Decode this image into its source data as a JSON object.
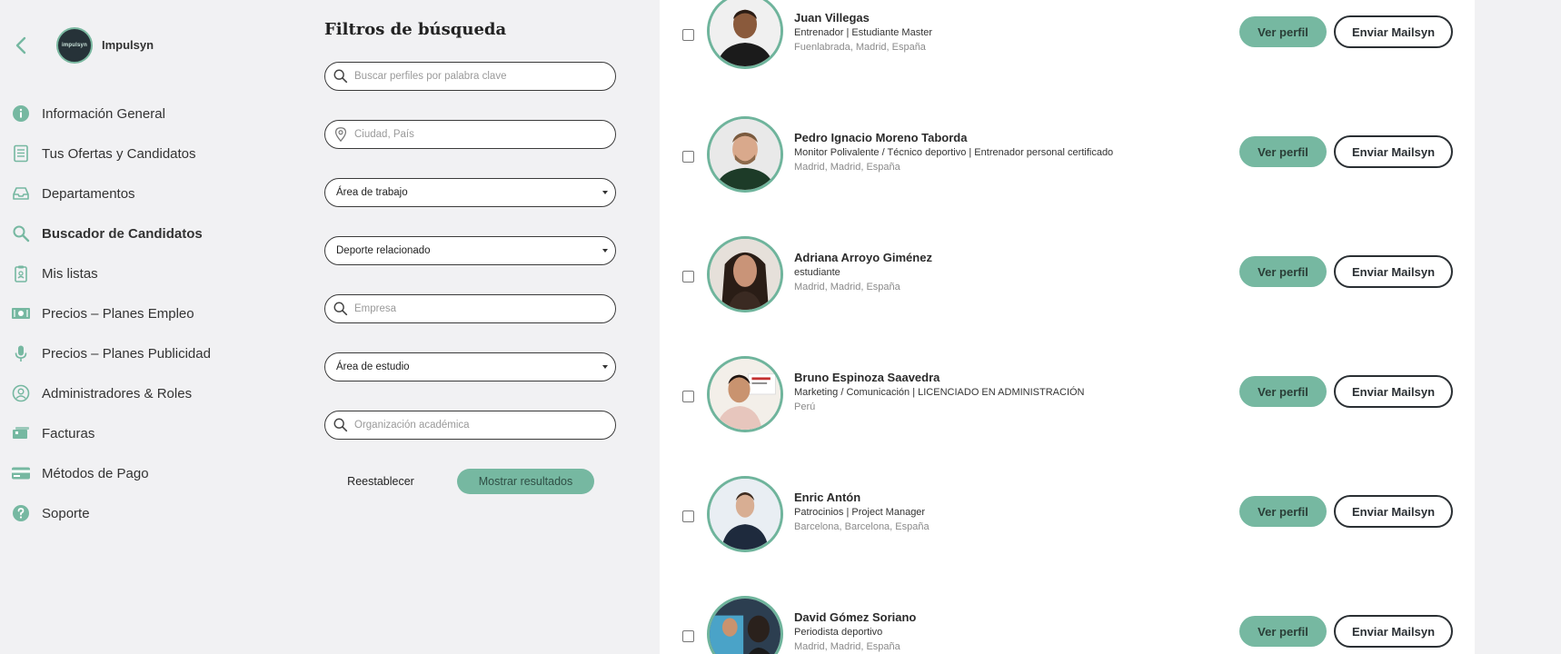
{
  "sidebar": {
    "company_name": "Impulsyn",
    "logo_text": "impulsyn",
    "items": [
      {
        "label": "Información General",
        "icon": "info-icon"
      },
      {
        "label": "Tus Ofertas y Candidatos",
        "icon": "document-list-icon"
      },
      {
        "label": "Departamentos",
        "icon": "inbox-icon"
      },
      {
        "label": "Buscador de Candidatos",
        "icon": "search-icon",
        "active": true
      },
      {
        "label": "Mis listas",
        "icon": "clipboard-icon"
      },
      {
        "label": "Precios – Planes Empleo",
        "icon": "banknote-icon"
      },
      {
        "label": "Precios – Planes Publicidad",
        "icon": "microphone-icon"
      },
      {
        "label": "Administradores & Roles",
        "icon": "user-circle-icon"
      },
      {
        "label": "Facturas",
        "icon": "invoice-stack-icon"
      },
      {
        "label": "Métodos de Pago",
        "icon": "credit-card-icon"
      },
      {
        "label": "Soporte",
        "icon": "help-icon"
      }
    ]
  },
  "filters": {
    "title": "Filtros de búsqueda",
    "keyword_placeholder": "Buscar perfiles por palabra clave",
    "location_placeholder": "Ciudad, País",
    "work_area": "Área de trabajo",
    "sport": "Deporte relacionado",
    "company_placeholder": "Empresa",
    "study_area": "Área de estudio",
    "academic_placeholder": "Organización académica",
    "reset_label": "Reestablecer",
    "show_label": "Mostrar resultados"
  },
  "candidates": [
    {
      "name": "Juan Villegas",
      "title": "Entrenador | Estudiante Master",
      "location": "Fuenlabrada, Madrid, España"
    },
    {
      "name": "Pedro Ignacio Moreno Taborda",
      "title": "Monitor Polivalente / Técnico deportivo | Entrenador personal certificado",
      "location": "Madrid, Madrid, España"
    },
    {
      "name": "Adriana Arroyo Giménez",
      "title": "estudiante",
      "location": "Madrid, Madrid, España"
    },
    {
      "name": "Bruno Espinoza Saavedra",
      "title": "Marketing / Comunicación | LICENCIADO EN ADMINISTRACIÓN",
      "location": "Perú"
    },
    {
      "name": "Enric Antón",
      "title": "Patrocinios | Project Manager",
      "location": "Barcelona, Barcelona, España"
    },
    {
      "name": "David Gómez Soriano",
      "title": "Periodista deportivo",
      "location": "Madrid, Madrid, España"
    }
  ],
  "actions": {
    "view_profile": "Ver perfil",
    "send_mail": "Enviar Mailsyn"
  },
  "colors": {
    "accent": "#76b8a1",
    "background": "#f1f1f3",
    "card": "#ffffff"
  }
}
